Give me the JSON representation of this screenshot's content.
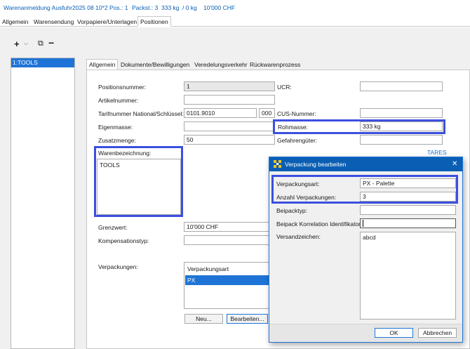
{
  "header": {
    "title": "Warenanmeldung Ausfuhr",
    "number": "2025 08 10*2",
    "pos": "Pos.: 1",
    "packst": "Packst.: 3",
    "weight": "333 kg",
    "weight2": "/ 0 kg",
    "value": "10'000 CHF"
  },
  "main_tabs": [
    "Allgemein",
    "Warensendung",
    "Vorpapiere/Unterlagen",
    "Positionen"
  ],
  "toolbar": {
    "add": "+",
    "dropdown": "⌵",
    "copy": "⧉",
    "remove": "−"
  },
  "position_list": {
    "items": [
      "1:TOOLS"
    ]
  },
  "sub_tabs": [
    "Allgemein",
    "Dokumente/Bewilligungen",
    "Veredelungsverkehr",
    "Rückwarenprozess"
  ],
  "form": {
    "positionsnummer_label": "Positionsnummer:",
    "positionsnummer_value": "1",
    "artikelnummer_label": "Artikelnummer:",
    "artikelnummer_value": "",
    "tarif_label": "Tarifnummer National/Schlüssel:",
    "tarif_value": "0101.9010",
    "tarif_key": "000",
    "eigenmasse_label": "Eigenmasse:",
    "eigenmasse_value": "",
    "zusatzmenge_label": "Zusatzmenge:",
    "zusatzmenge_value": "50",
    "ucr_label": "UCR:",
    "ucr_value": "",
    "cus_label": "CUS-Nummer:",
    "cus_value": "",
    "rohmasse_label": "Rohmasse:",
    "rohmasse_value": "333 kg",
    "gefahrengueter_label": "Gefahrengüter:",
    "gefahrengueter_value": "",
    "tares_link": "TARES",
    "warenbezeichnung_label": "Warenbezeichnung:",
    "warenbezeichnung_value": "TOOLS",
    "grenzwert_label": "Grenzwert:",
    "grenzwert_value": "10'000 CHF",
    "kompensationstyp_label": "Kompensationstyp:",
    "kompensationstyp_value": "",
    "verpackungen_label": "Verpackungen:",
    "verpackungen_header": "Verpackungsart",
    "verpackungen_rows": [
      "PX"
    ],
    "neu_button": "Neu...",
    "bearbeiten_button": "Bearbeiten..."
  },
  "dialog": {
    "title": "Verpackung bearbeiten",
    "close": "✕",
    "verpackungsart_label": "Verpackungsart:",
    "verpackungsart_value": "PX - Palette",
    "anzahl_label": "Anzahl Verpackungen:",
    "anzahl_value": "3",
    "beipacktyp_label": "Beipacktyp:",
    "beipacktyp_value": "",
    "beipack_korr_label": "Beipack Korrelation Identifikator:",
    "beipack_korr_value": "",
    "versandzeichen_label": "Versandzeichen:",
    "versandzeichen_value": "abcd",
    "ok_button": "OK",
    "abbrechen_button": "Abbrechen"
  },
  "colors": {
    "accent": "#0a5fb4",
    "highlight": "#3b4fe0",
    "selection": "#1e74d6",
    "tab_active": "#ffffff"
  }
}
